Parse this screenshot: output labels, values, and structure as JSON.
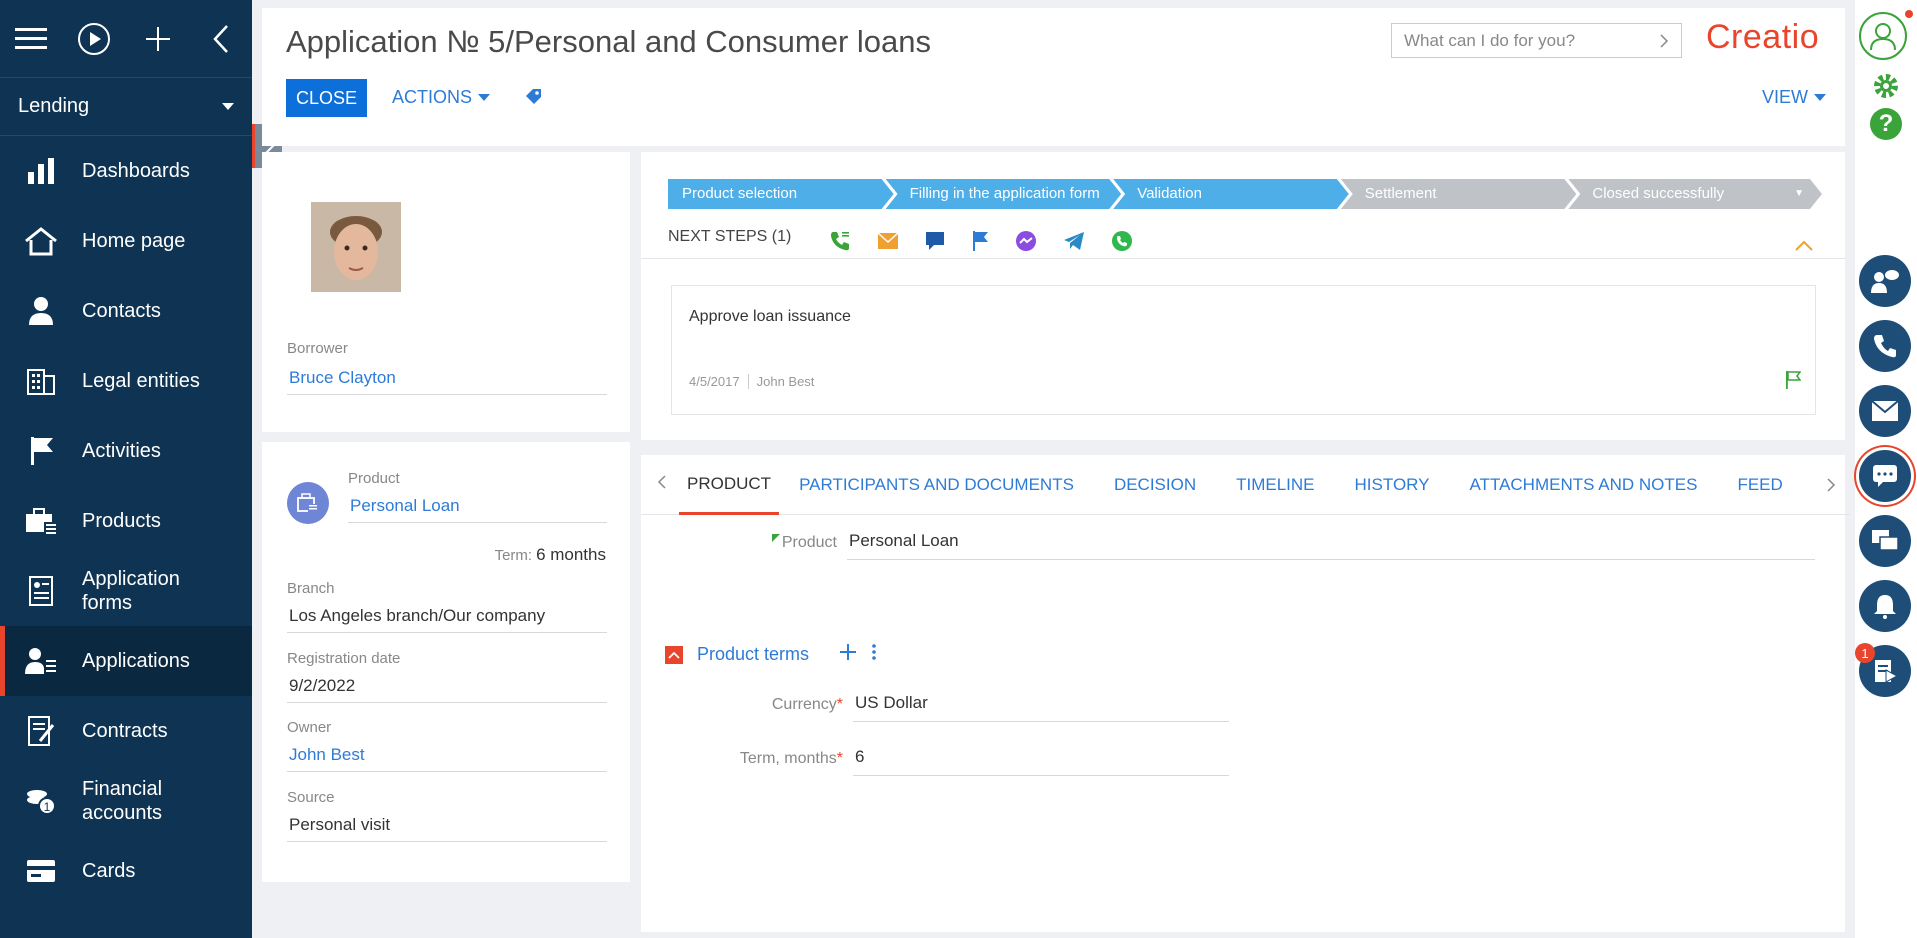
{
  "sidebar": {
    "workspace": "Lending",
    "items": [
      {
        "label": "Dashboards",
        "icon": "bar-chart-icon"
      },
      {
        "label": "Home page",
        "icon": "home-icon"
      },
      {
        "label": "Contacts",
        "icon": "person-icon"
      },
      {
        "label": "Legal entities",
        "icon": "building-icon"
      },
      {
        "label": "Activities",
        "icon": "flag-icon"
      },
      {
        "label": "Products",
        "icon": "briefcase-icon"
      },
      {
        "label": "Application forms",
        "icon": "form-icon"
      },
      {
        "label": "Applications",
        "icon": "person-list-icon",
        "active": true
      },
      {
        "label": "Contracts",
        "icon": "contract-icon"
      },
      {
        "label": "Financial accounts",
        "icon": "coins-icon"
      },
      {
        "label": "Cards",
        "icon": "card-icon"
      }
    ]
  },
  "header": {
    "title": "Application № 5/Personal and Consumer loans",
    "close_label": "CLOSE",
    "actions_label": "ACTIONS",
    "view_label": "VIEW",
    "search_placeholder": "What can I do for you?",
    "logo": "Creatio"
  },
  "borrower": {
    "label": "Borrower",
    "value": "Bruce Clayton"
  },
  "product_card": {
    "product_label": "Product",
    "product_value": "Personal Loan",
    "term_label": "Term:",
    "term_value": "6 months",
    "branch_label": "Branch",
    "branch_value": "Los Angeles branch/Our company",
    "registration_label": "Registration date",
    "registration_value": "9/2/2022",
    "owner_label": "Owner",
    "owner_value": "John Best",
    "source_label": "Source",
    "source_value": "Personal visit"
  },
  "stages": [
    {
      "label": "Product selection",
      "status": "done"
    },
    {
      "label": "Filling in the application form",
      "status": "done"
    },
    {
      "label": "Validation",
      "status": "done"
    },
    {
      "label": "Settlement",
      "status": "todo"
    },
    {
      "label": "Closed successfully",
      "status": "todo"
    }
  ],
  "next_steps": {
    "label": "NEXT STEPS (1)",
    "task_title": "Approve loan issuance",
    "task_date": "4/5/2017",
    "task_owner": "John Best"
  },
  "tabs": [
    {
      "label": "PRODUCT",
      "active": true
    },
    {
      "label": "PARTICIPANTS AND DOCUMENTS"
    },
    {
      "label": "DECISION"
    },
    {
      "label": "TIMELINE"
    },
    {
      "label": "HISTORY"
    },
    {
      "label": "ATTACHMENTS AND NOTES"
    },
    {
      "label": "FEED"
    }
  ],
  "product_tab": {
    "product_label": "Product",
    "product_value": "Personal Loan",
    "terms_section": "Product terms",
    "currency_label": "Currency",
    "currency_value": "US Dollar",
    "term_label": "Term, months",
    "term_value": "6"
  },
  "notifications_badge": "1",
  "colors": {
    "sidebar": "#0f3352",
    "accent": "#e8452c",
    "link": "#2e7bd6",
    "stage_done": "#4eaee8",
    "stage_todo": "#bfc3c7",
    "primary_button": "#0d6fd9"
  }
}
